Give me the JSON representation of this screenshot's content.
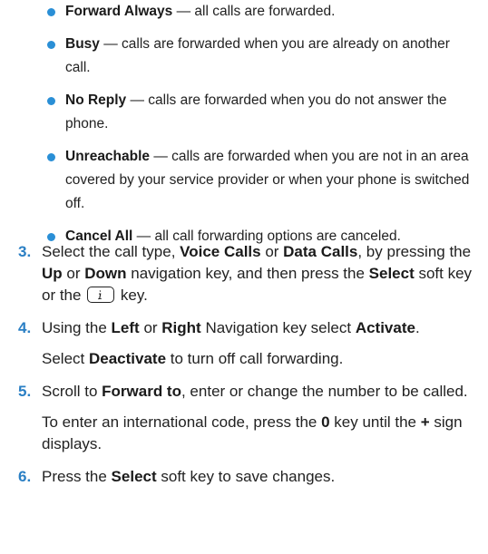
{
  "bullets": [
    {
      "term": "Forward Always",
      "desc": " — all calls are forwarded."
    },
    {
      "term": "Busy",
      "desc": " — calls are forwarded when you are already on another call."
    },
    {
      "term": "No Reply",
      "desc": " — calls are forwarded when you do not answer the phone."
    },
    {
      "term": "Unreachable",
      "desc": " — calls are forwarded when you are not in an area covered by your service provider or when your phone is switched off."
    },
    {
      "term": "Cancel All",
      "desc": " — all call forwarding options are canceled."
    }
  ],
  "steps": {
    "s3": {
      "num": "3.",
      "t1": "Select the call type, ",
      "b1": "Voice Calls",
      "t2": " or ",
      "b2": "Data Calls",
      "t3": ", by pressing the ",
      "b3": "Up",
      "t4": " or ",
      "b4": "Down",
      "t5": " navigation key, and then press the ",
      "b5": "Select",
      "t6": " soft key or the ",
      "t7": " key."
    },
    "s4": {
      "num": "4.",
      "t1": "Using the ",
      "b1": "Left",
      "t2": " or ",
      "b2": "Right",
      "t3": " Navigation key select ",
      "b3": "Activate",
      "t4": ".",
      "sub_t1": "Select ",
      "sub_b1": "Deactivate",
      "sub_t2": " to turn off call forwarding."
    },
    "s5": {
      "num": "5.",
      "t1": "Scroll to ",
      "b1": "Forward to",
      "t2": ", enter or change the number to be called.",
      "sub_t1": "To enter an international code, press the ",
      "sub_b1": "0",
      "sub_t2": " key until the ",
      "sub_b2": "+",
      "sub_t3": " sign displays."
    },
    "s6": {
      "num": "6.",
      "t1": "Press the ",
      "b1": "Select",
      "t2": " soft key to save changes."
    }
  },
  "icons": {
    "menu_key": "menu-key-icon"
  },
  "colors": {
    "bullet": "#2a8fd6",
    "step_number": "#2a7fc4"
  }
}
